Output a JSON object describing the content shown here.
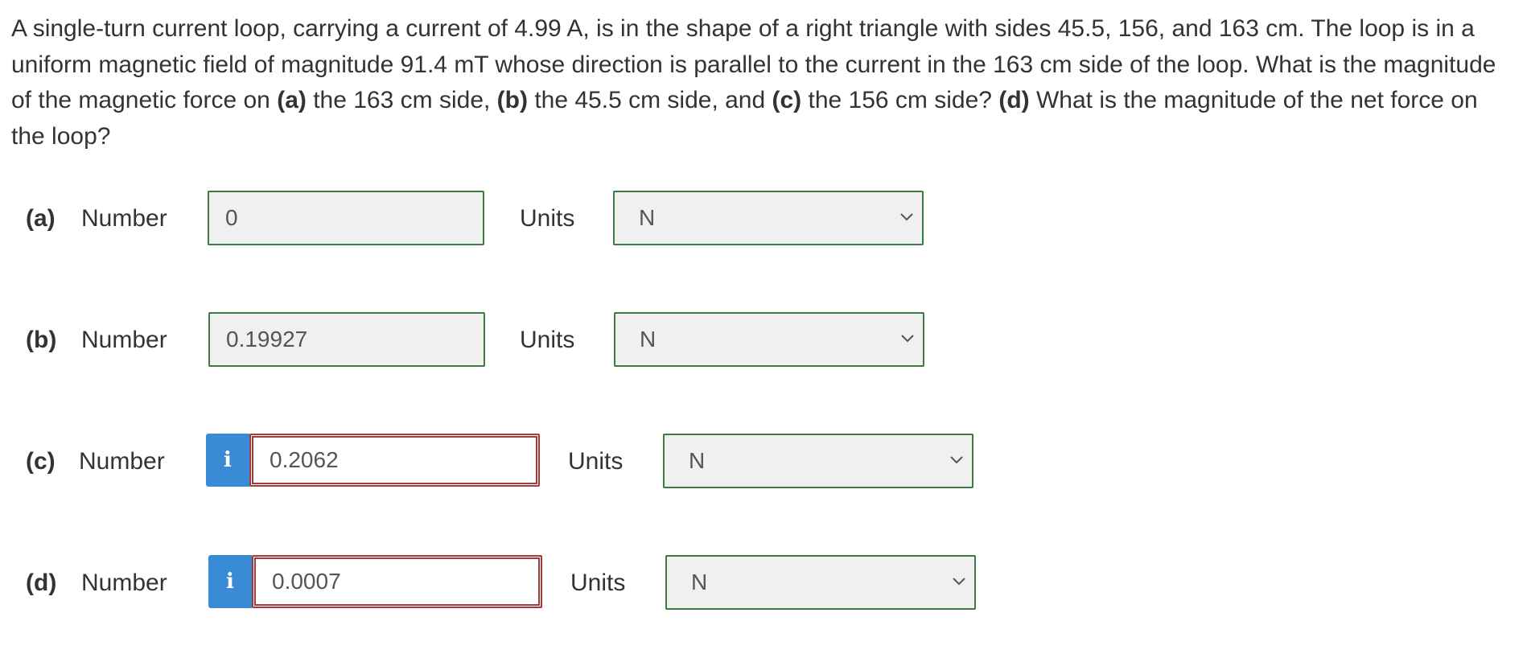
{
  "question": {
    "text_1": "A single-turn current loop, carrying a current of 4.99 A, is in the shape of a right triangle with sides 45.5, 156, and 163 cm. The loop is in a uniform magnetic field of magnitude 91.4 mT whose direction is parallel to the current in the 163 cm side of the loop. What is the magnitude of the magnetic force on ",
    "part_a": "(a)",
    "text_2": " the 163 cm side, ",
    "part_b": "(b)",
    "text_3": " the 45.5 cm side, and ",
    "part_c": "(c)",
    "text_4": " the 156 cm side? ",
    "part_d": "(d)",
    "text_5": " What is the magnitude of the net force on the loop?"
  },
  "answers": [
    {
      "part": "(a)",
      "number_label": "Number",
      "value": "0",
      "units_label": "Units",
      "unit": "N",
      "status": "ok"
    },
    {
      "part": "(b)",
      "number_label": "Number",
      "value": "0.19927",
      "units_label": "Units",
      "unit": "N",
      "status": "ok"
    },
    {
      "part": "(c)",
      "number_label": "Number",
      "value": "0.2062",
      "units_label": "Units",
      "unit": "N",
      "status": "wrong",
      "badge": "i"
    },
    {
      "part": "(d)",
      "number_label": "Number",
      "value": "0.0007",
      "units_label": "Units",
      "unit": "N",
      "status": "wrong",
      "badge": "i"
    }
  ],
  "colors": {
    "correct_border": "#3d7a3d",
    "wrong_border": "#a33a3a",
    "info_badge": "#3a8bd6"
  },
  "icons": {
    "select_arrow": "chevron-down-icon",
    "info": "info-icon"
  }
}
